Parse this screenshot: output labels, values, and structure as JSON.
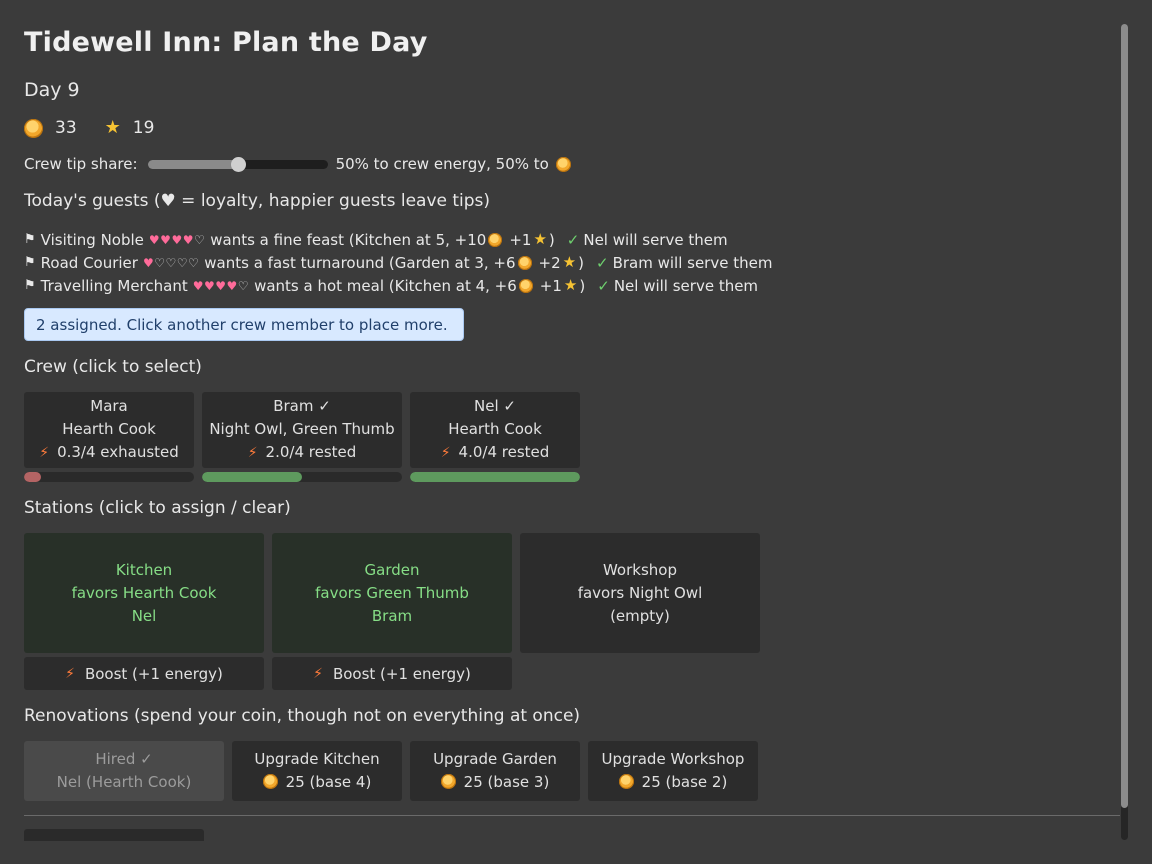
{
  "title": "Tidewell Inn: Plan the Day",
  "day": "Day 9",
  "stats": {
    "coins": "33",
    "stars": "19"
  },
  "tip": {
    "label": "Crew tip share:",
    "value": 0.5,
    "text": "50% to crew energy, 50% to"
  },
  "guests_header": "Today's guests  (♥ = loyalty, happier guests leave tips)",
  "guests": [
    {
      "name": "Visiting Noble",
      "loyalty": 4,
      "want": "wants a fine feast (Kitchen at 5, +10",
      "star_gain": "+1",
      "server": "Nel will serve them"
    },
    {
      "name": "Road Courier",
      "loyalty": 1,
      "want": "wants a fast turnaround (Garden at 3, +6",
      "star_gain": "+2",
      "server": "Bram will serve them"
    },
    {
      "name": "Travelling Merchant",
      "loyalty": 4,
      "want": "wants a hot meal (Kitchen at 4, +6",
      "star_gain": "+1",
      "server": "Nel will serve them"
    }
  ],
  "notice": "2 assigned. Click another crew member to place more.",
  "crew_header": "Crew  (click to select)",
  "crew": [
    {
      "name": "Mara",
      "traits": "Hearth Cook",
      "energy": "0.3/4  exhausted",
      "energy_frac": 0.075,
      "bar_color": "#b46464"
    },
    {
      "name": "Bram ✓",
      "traits": "Night Owl, Green Thumb",
      "energy": "2.0/4  rested",
      "energy_frac": 0.5,
      "bar_color": "#5e9a5e"
    },
    {
      "name": "Nel ✓",
      "traits": "Hearth Cook",
      "energy": "4.0/4  rested",
      "energy_frac": 1.0,
      "bar_color": "#5e9a5e"
    }
  ],
  "stations_header": "Stations  (click to assign / clear)",
  "stations": [
    {
      "name": "Kitchen",
      "favors": "favors Hearth Cook",
      "assigned": "Nel",
      "boost": "Boost (+1 energy)"
    },
    {
      "name": "Garden",
      "favors": "favors Green Thumb",
      "assigned": "Bram",
      "boost": "Boost (+1 energy)"
    },
    {
      "name": "Workshop",
      "favors": "favors Night Owl",
      "assigned": "(empty)"
    }
  ],
  "renos_header": "Renovations  (spend your coin, though not on everything at once)",
  "renos": [
    {
      "title": "Hired ✓",
      "detail": "Nel (Hearth Cook)"
    },
    {
      "title": "Upgrade Kitchen",
      "detail": "25  (base 4)"
    },
    {
      "title": "Upgrade Garden",
      "detail": "25  (base 3)"
    },
    {
      "title": "Upgrade Workshop",
      "detail": "25  (base 2)"
    }
  ]
}
